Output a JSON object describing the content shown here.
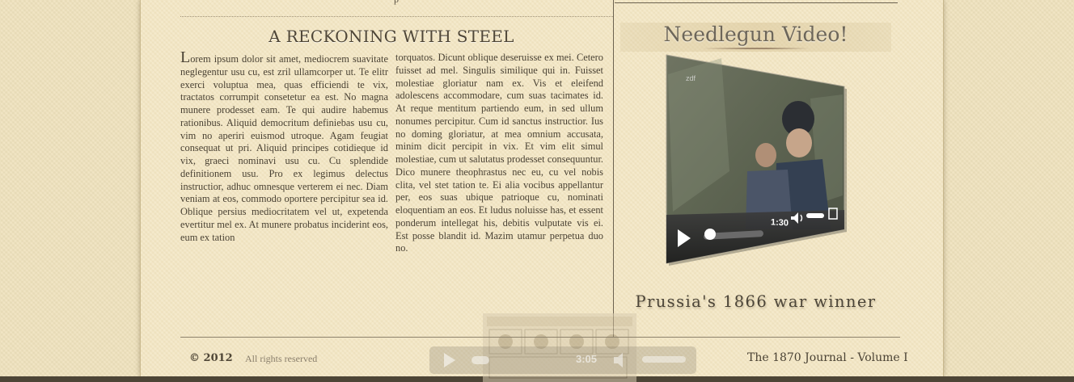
{
  "header": {
    "crumb": "p"
  },
  "article": {
    "title": "A RECKONING WITH STEEL",
    "col1_dropcap": "L",
    "col1_text": "orem ipsum dolor sit amet, mediocrem suavitate neglegentur usu cu, est zril ullamcorper ut. Te elitr exerci voluptua mea, quas efficiendi te vix, tractatos corrumpit consetetur ea est. No magna munere prodesset eam. Te qui audire habemus rationibus. Aliquid democritum definiebas usu cu, vim no aperiri euismod utroque. Agam feugiat consequat ut pri. Aliquid principes cotidieque id vix, graeci nominavi usu cu. Cu splendide definitionem usu. Pro ex legimus delectus instructior, adhuc omnesque verterem ei nec. Diam veniam at eos, commodo oportere percipitur sea id. Oblique persius mediocritatem vel ut, expetenda evertitur mel ex. At munere probatus inciderint eos, eum ex tation",
    "col2_text": "torquatos. Dicunt oblique deseruisse ex mei. Cetero fuisset ad mel. Singulis similique qui in. Fuisset molestiae gloriatur nam ex. Vis et eleifend adolescens accommodare, cum suas tacimates id. At reque mentitum partiendo eum, in sed ullum nonumes percipitur. Cum id sanctus instructior. Ius no doming gloriatur, at mea omnium accusata, minim dicit percipit in vix. Et vim elit simul molestiae, cum ut salutatus prodesset consequuntur. Dico munere theophrastus nec eu, cu vel nobis clita, vel stet tation te. Ei alia vocibus appellantur per, eos suas ubique patrioque cu, nominati eloquentiam an eos. Et ludus noluisse has, et essent ponderum intellegat his, debitis vulputate vis ei. Est posse blandit id. Mazim utamur perpetua duo no."
  },
  "sidebar": {
    "video_heading": "Needlegun Video!",
    "video_time": "1:30",
    "video_progress": 0.02,
    "video_volume": 0.7,
    "video_caption": "Prussia's 1866 war winner"
  },
  "footer": {
    "copyright": "© 2012",
    "rights": "All rights reserved",
    "journal": "The 1870 Journal - Volume I"
  },
  "mini_player": {
    "time": "3:05"
  },
  "colors": {
    "paper": "#f3e7c5",
    "ink": "#4a4234",
    "rule": "#6c6250"
  }
}
